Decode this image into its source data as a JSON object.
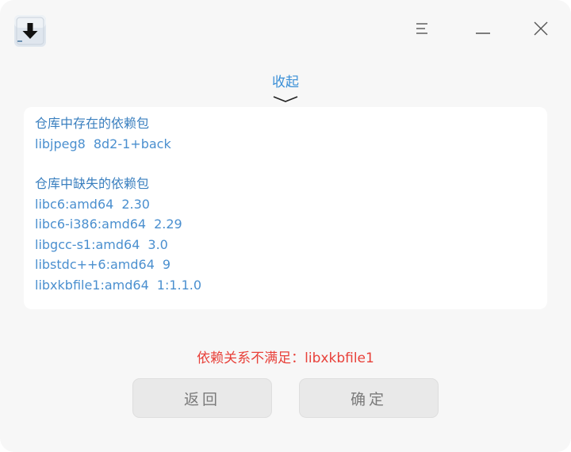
{
  "window": {
    "app_icon": "download-icon",
    "controls": {
      "menu_icon": "menu-icon",
      "minimize_icon": "minimize-icon",
      "close_icon": "close-icon"
    }
  },
  "details": {
    "collapse_label": "收起",
    "collapse_icon": "chevron-down-icon",
    "existing_title": "仓库中存在的依赖包",
    "existing": [
      {
        "name": "libjpeg8",
        "version": "8d2-1+back"
      }
    ],
    "missing_title": "仓库中缺失的依赖包",
    "missing": [
      {
        "name": "libc6:amd64",
        "version": "2.30"
      },
      {
        "name": "libc6-i386:amd64",
        "version": "2.29"
      },
      {
        "name": "libgcc-s1:amd64",
        "version": "3.0"
      },
      {
        "name": "libstdc++6:amd64",
        "version": "9"
      },
      {
        "name": "libxkbfile1:amd64",
        "version": "1:1.1.0"
      }
    ]
  },
  "status": {
    "error_text": "依赖关系不满足：libxkbfile1",
    "error_color": "#e8413a"
  },
  "buttons": {
    "back_label": "返回",
    "ok_label": "确定"
  },
  "colors": {
    "accent": "#3a8fd7",
    "background": "#f7f7f7",
    "panel": "#ffffff"
  }
}
